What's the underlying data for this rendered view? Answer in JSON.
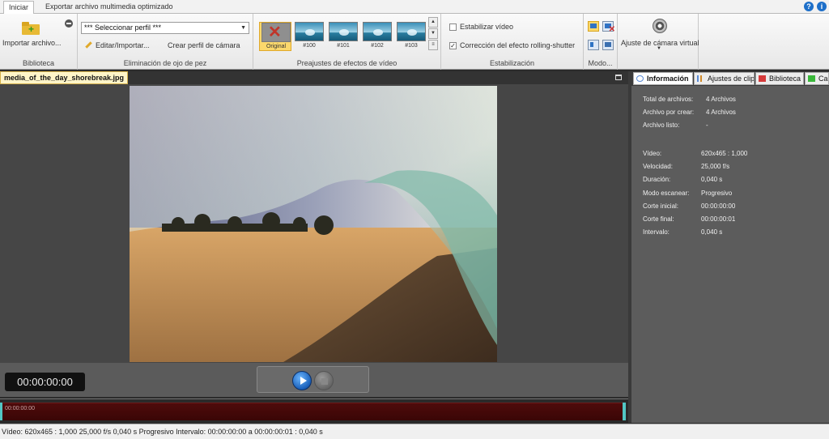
{
  "tabs": [
    {
      "label": "Iniciar",
      "active": true
    },
    {
      "label": "Exportar archivo multimedia optimizado",
      "active": false
    }
  ],
  "ribbon": {
    "library": {
      "import_label": "Importar archivo...",
      "group_label": "Biblioteca"
    },
    "fisheye": {
      "profile_select": "*** Seleccionar perfil ***",
      "edit_import_label": "Editar/Importar...",
      "create_profile_label": "Crear perfil de cámara",
      "group_label": "Eliminación de ojo de pez"
    },
    "presets": {
      "items": [
        {
          "label": "Original",
          "selected": true
        },
        {
          "label": "#100",
          "selected": false
        },
        {
          "label": "#101",
          "selected": false
        },
        {
          "label": "#102",
          "selected": false
        },
        {
          "label": "#103",
          "selected": false
        }
      ],
      "group_label": "Preajustes de efectos de vídeo"
    },
    "stabilization": {
      "stabilize_label": "Estabilizar vídeo",
      "stabilize_checked": false,
      "rolling_label": "Corrección del efecto rolling-shutter",
      "rolling_checked": true,
      "group_label": "Estabilización"
    },
    "mode": {
      "group_label": "Modo..."
    },
    "virtual_camera": {
      "label": "Ajuste de cámara virtual"
    }
  },
  "preview": {
    "file_tab": "media_of_the_day_shorebreak.jpg",
    "timecode": "00:00:00:00",
    "timeline_time": "00:00:00:00"
  },
  "info_panel": {
    "tabs": [
      "Información",
      "Ajustes de clip",
      "Biblioteca",
      "Can"
    ],
    "summary": [
      {
        "label": "Total de archivos:",
        "value": "4 Archivos"
      },
      {
        "label": "Archivo por crear:",
        "value": "4 Archivos"
      },
      {
        "label": "Archivo listo:",
        "value": "-"
      }
    ],
    "media": [
      {
        "label": "Vídeo:",
        "value": "620x465 : 1,000"
      },
      {
        "label": "Velocidad:",
        "value": "25,000 f/s"
      },
      {
        "label": "Duración:",
        "value": "0,040 s"
      },
      {
        "label": "Modo escanear:",
        "value": "Progresivo"
      },
      {
        "label": "Corte inicial:",
        "value": "00:00:00:00"
      },
      {
        "label": "Corte final:",
        "value": "00:00:00:01"
      },
      {
        "label": "Intervalo:",
        "value": "0,040 s"
      }
    ]
  },
  "status_bar": {
    "text": "Vídeo: 620x465 : 1,000   25,000 f/s   0,040 s   Progresivo   Intervalo: 00:00:00:00 a 00:00:00:01 : 0,040 s"
  },
  "colors": {
    "accent_yellow": "#fbd86c",
    "timeline_red": "#4e0b0b",
    "handle_teal": "#52c7c4",
    "play_blue": "#1a5fb8"
  }
}
